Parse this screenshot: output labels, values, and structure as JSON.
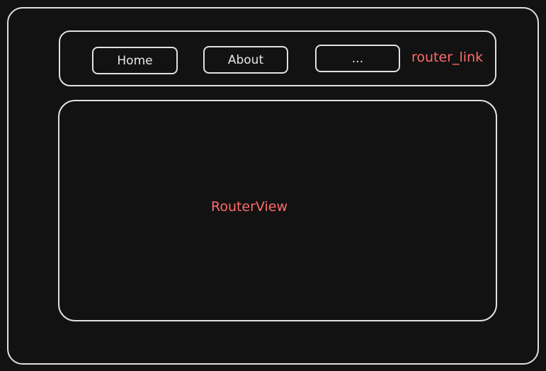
{
  "nav": {
    "buttons": [
      {
        "label": "Home"
      },
      {
        "label": "About"
      },
      {
        "label": "..."
      }
    ],
    "annotation": "router_link"
  },
  "view": {
    "label": "RouterView"
  },
  "colors": {
    "background": "#121212",
    "stroke": "#e0e0e0",
    "accent": "#ff6b6b"
  }
}
